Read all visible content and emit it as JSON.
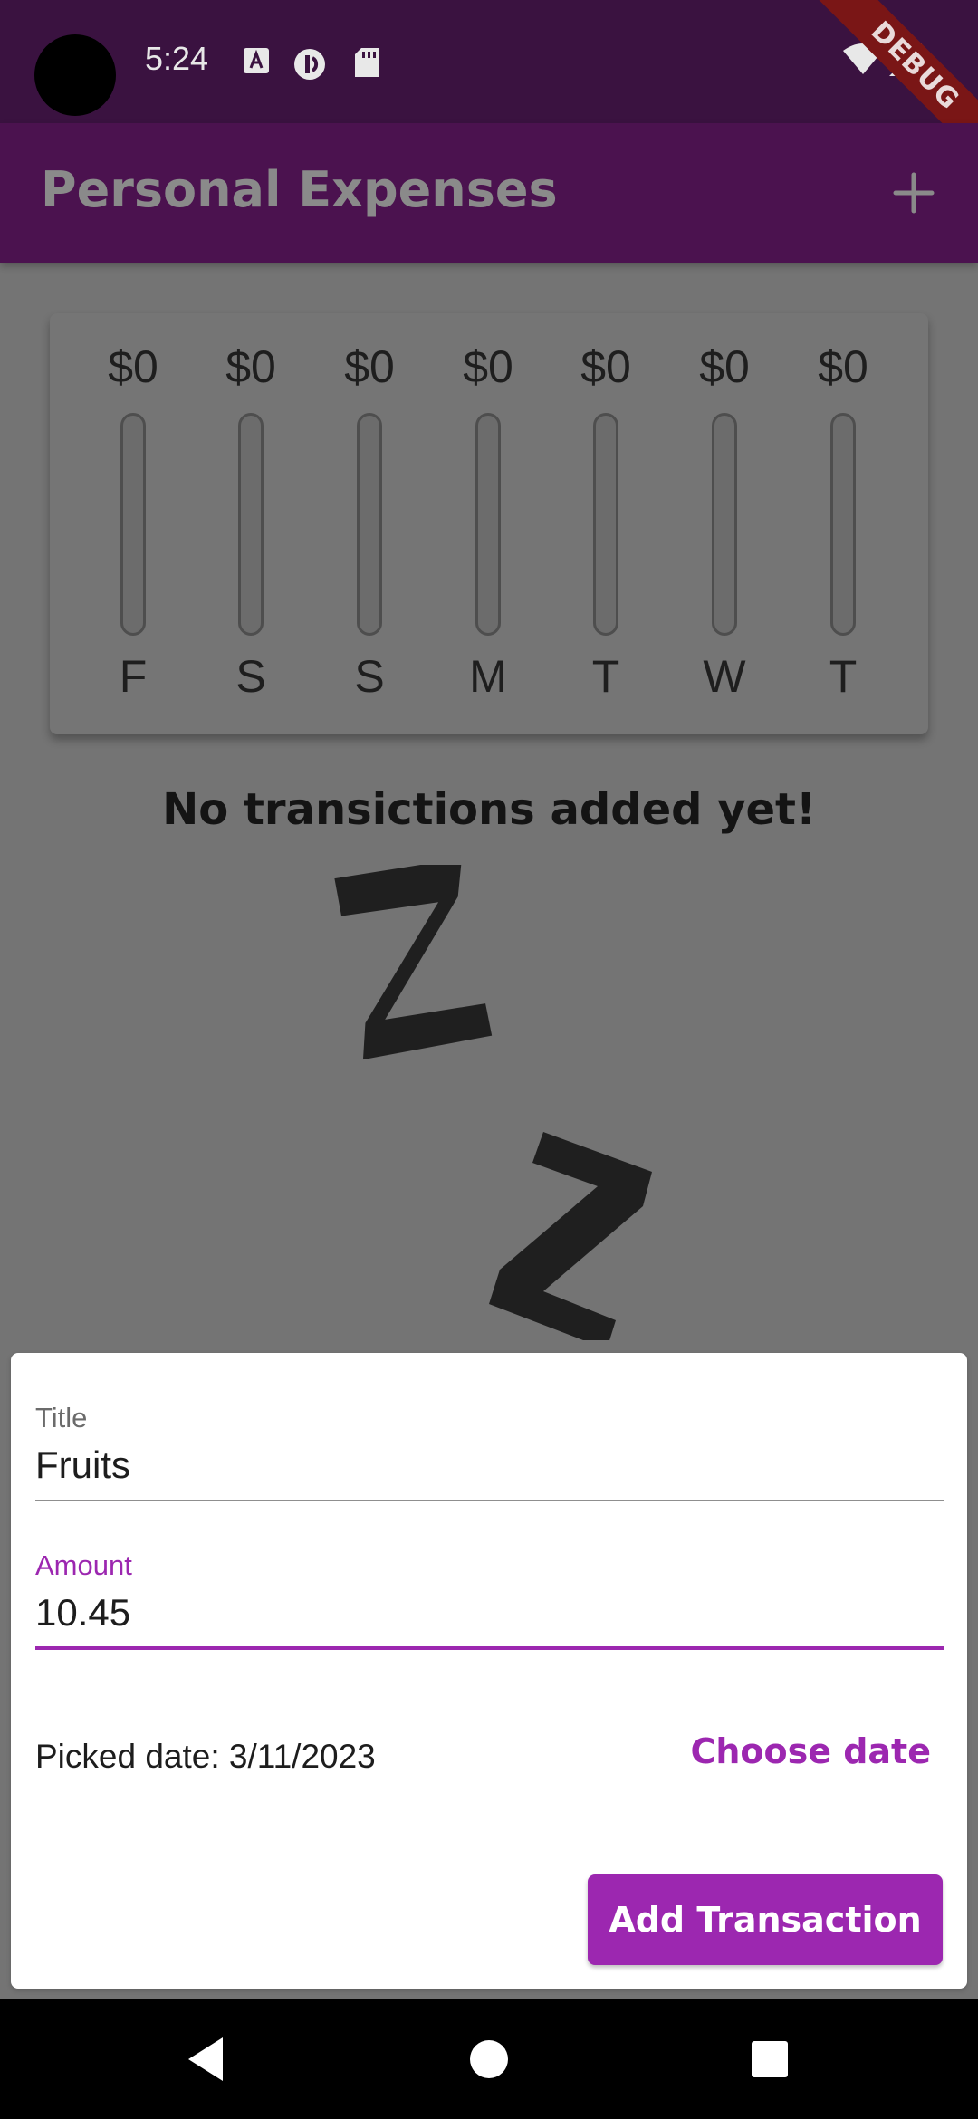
{
  "status_bar": {
    "time": "5:24",
    "icons": [
      "text-a-icon",
      "data-saver-icon",
      "sd-card-icon",
      "wifi-icon",
      "signal-icon"
    ],
    "debug_banner": "DEBUG"
  },
  "app_bar": {
    "title": "Personal Expenses",
    "action_icon": "add-icon"
  },
  "chart": {
    "days": [
      {
        "label": "F",
        "amount": "$0",
        "fill": 0
      },
      {
        "label": "S",
        "amount": "$0",
        "fill": 0
      },
      {
        "label": "S",
        "amount": "$0",
        "fill": 0
      },
      {
        "label": "M",
        "amount": "$0",
        "fill": 0
      },
      {
        "label": "T",
        "amount": "$0",
        "fill": 0
      },
      {
        "label": "W",
        "amount": "$0",
        "fill": 0
      },
      {
        "label": "T",
        "amount": "$0",
        "fill": 0
      }
    ]
  },
  "empty_state": {
    "message": "No transictions added yet!",
    "image_icon": "sleeping-z-icon"
  },
  "form": {
    "title_field": {
      "label": "Title",
      "value": "Fruits"
    },
    "amount_field": {
      "label": "Amount",
      "value": "10.45"
    },
    "picked_date": "Picked date: 3/11/2023",
    "choose_date_label": "Choose date",
    "submit_label": "Add Transaction"
  },
  "nav_bar": {
    "icons": [
      "back-icon",
      "home-icon",
      "recents-icon"
    ]
  },
  "colors": {
    "primary": "#9c27b0",
    "app_bar": "#4b124f",
    "status_bar": "#3a1240"
  }
}
